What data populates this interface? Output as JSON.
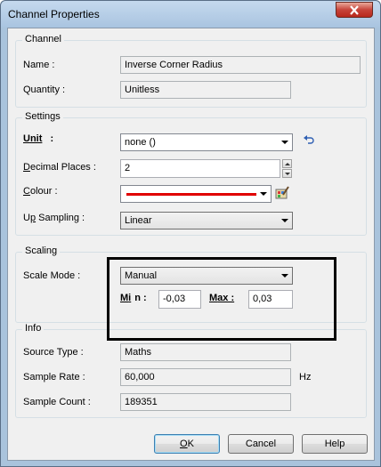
{
  "window": {
    "title": "Channel Properties"
  },
  "channel": {
    "group_label": "Channel",
    "name_label": "Name :",
    "name_value": "Inverse Corner Radius",
    "quantity_label": "Quantity :",
    "quantity_value": "Unitless"
  },
  "settings": {
    "group_label": "Settings",
    "unit_label_u": "U",
    "unit_label_rest": "nit",
    "unit_colon": ":",
    "unit_value": "none ()",
    "decimal_label_u": "D",
    "decimal_label_rest": "ecimal Places :",
    "decimal_value": "2",
    "colour_label_u": "C",
    "colour_label_rest": "olour :",
    "colour_value": "#e00000",
    "upsampling_label_pre": "U",
    "upsampling_label_u": "p",
    "upsampling_label_rest": " Sampling :",
    "upsampling_value": "Linear"
  },
  "scaling": {
    "group_label": "Scaling",
    "mode_label": "Scale Mode :",
    "mode_value": "Manual",
    "min_label_pre": "M",
    "min_label_u": "i",
    "min_label_rest": "n :",
    "min_value": "-0,03",
    "max_label_u": "M",
    "max_label_rest": "ax :",
    "max_value": "0,03"
  },
  "info": {
    "group_label": "Info",
    "source_label": "Source Type :",
    "source_value": "Maths",
    "rate_label": "Sample Rate :",
    "rate_value": "60,000",
    "rate_unit": "Hz",
    "count_label": "Sample Count :",
    "count_value": "189351"
  },
  "buttons": {
    "ok_u": "O",
    "ok_rest": "K",
    "cancel": "Cancel",
    "help": "Help"
  },
  "icons": {
    "close": "close-icon",
    "reset_unit": "undo-arrow-icon",
    "colour_picker": "palette-icon"
  }
}
